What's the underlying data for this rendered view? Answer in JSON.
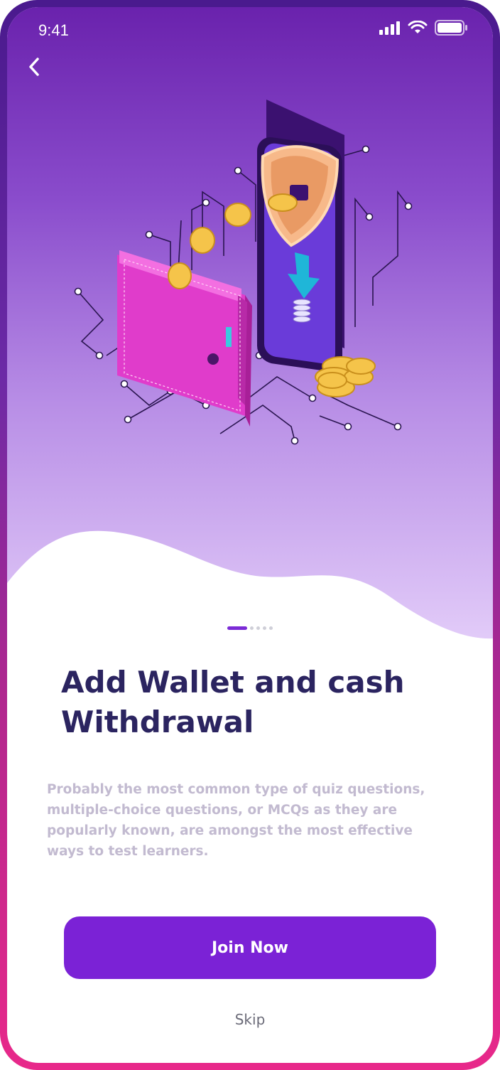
{
  "status_bar": {
    "time": "9:41",
    "icons": [
      "cellular-signal-icon",
      "wifi-icon",
      "battery-icon"
    ]
  },
  "navigation": {
    "back_icon": "chevron-left-icon"
  },
  "illustration": {
    "subject": "wallet-to-phone-transfer-illustration",
    "elements": [
      "pink-wallet",
      "smartphone",
      "shield",
      "gold-coins",
      "circuit-lines",
      "download-arrow"
    ]
  },
  "pager": {
    "total": 5,
    "active": 0
  },
  "onboarding": {
    "title_line1": "Add Wallet and cash",
    "title_line2": "Withdrawal",
    "description_lines": [
      "Probably the most common type of quiz questions,",
      "multiple-choice questions, or MCQs as they are",
      "popularly known, are amongst the most effective",
      "ways to test learners."
    ]
  },
  "actions": {
    "join_label": "Join Now",
    "skip_label": "Skip"
  },
  "colors": {
    "primary": "#7B22D6",
    "title": "#2B2460",
    "description": "#C2BAD0",
    "frame_top": "#4A1A8E",
    "frame_bottom": "#E8288A"
  }
}
